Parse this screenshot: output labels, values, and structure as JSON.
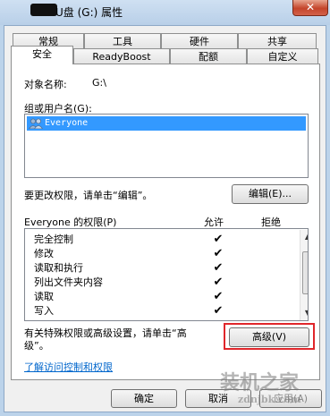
{
  "window": {
    "title": "U盘 (G:) 属性",
    "close_label": "✕"
  },
  "tabs": {
    "row1": [
      "常规",
      "工具",
      "硬件",
      "共享"
    ],
    "row2": [
      "安全",
      "ReadyBoost",
      "配额",
      "自定义"
    ],
    "active": "安全"
  },
  "security": {
    "object_label": "对象名称:",
    "object_value": "G:\\",
    "group_label": "组或用户名(G):",
    "users": [
      "Everyone"
    ],
    "change_text": "要更改权限，请单击“编辑”。",
    "edit_button": "编辑(E)...",
    "perm_header": "Everyone 的权限(P)",
    "allow_header": "允许",
    "deny_header": "拒绝",
    "permissions": [
      {
        "name": "完全控制",
        "allow": true
      },
      {
        "name": "修改",
        "allow": true
      },
      {
        "name": "读取和执行",
        "allow": true
      },
      {
        "name": "列出文件夹内容",
        "allow": true
      },
      {
        "name": "读取",
        "allow": true
      },
      {
        "name": "写入",
        "allow": true
      }
    ],
    "check_glyph": "✔",
    "special_text_1": "有关特殊权限或高级设置，请单击“高",
    "special_text_2": "级”。",
    "advanced_button": "高级(V)",
    "link_text": "了解访问控制和权限"
  },
  "footer": {
    "ok": "确定",
    "cancel": "取消",
    "apply": "应用(A)"
  },
  "watermark": {
    "line1": "装机之家",
    "line2": "zdnjbk.com"
  },
  "colors": {
    "selection": "#3399ff",
    "highlight_box": "#e0262b",
    "link": "#0066cc"
  }
}
